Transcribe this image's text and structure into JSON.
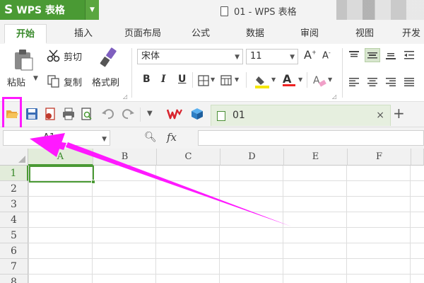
{
  "app": {
    "name": "WPS 表格",
    "logo_glyph": "S",
    "window_title": "01 - WPS 表格",
    "brand_color": "#4a9a34"
  },
  "menu_tabs": [
    {
      "label": "开始",
      "active": true
    },
    {
      "label": "插入"
    },
    {
      "label": "页面布局"
    },
    {
      "label": "公式"
    },
    {
      "label": "数据"
    },
    {
      "label": "审阅"
    },
    {
      "label": "视图"
    },
    {
      "label": "开发"
    }
  ],
  "ribbon": {
    "paste_label": "粘贴",
    "cut_label": "剪切",
    "copy_label": "复制",
    "format_painter_label": "格式刷",
    "font_name": "宋体",
    "font_size": "11",
    "bold": "B",
    "italic": "I",
    "underline": "U",
    "grow_font": "A",
    "shrink_font": "A",
    "font_color_letter": "A"
  },
  "quick_access": {
    "icons": [
      "open-folder-icon",
      "save-icon",
      "export-pdf-icon",
      "print-icon",
      "print-preview-icon",
      "undo-icon",
      "redo-icon",
      "customize-dropdown-icon"
    ],
    "highlight_color": "#ff19ff"
  },
  "doc_tabs": [
    {
      "label": "01",
      "close": "×"
    }
  ],
  "new_tab": "+",
  "formula_bar": {
    "name_box": "A1",
    "fx": "fx"
  },
  "grid": {
    "columns": [
      "A",
      "B",
      "C",
      "D",
      "E",
      "F"
    ],
    "rows": [
      "1",
      "2",
      "3",
      "4",
      "5",
      "6",
      "7",
      "8"
    ],
    "active_cell": "A1"
  }
}
